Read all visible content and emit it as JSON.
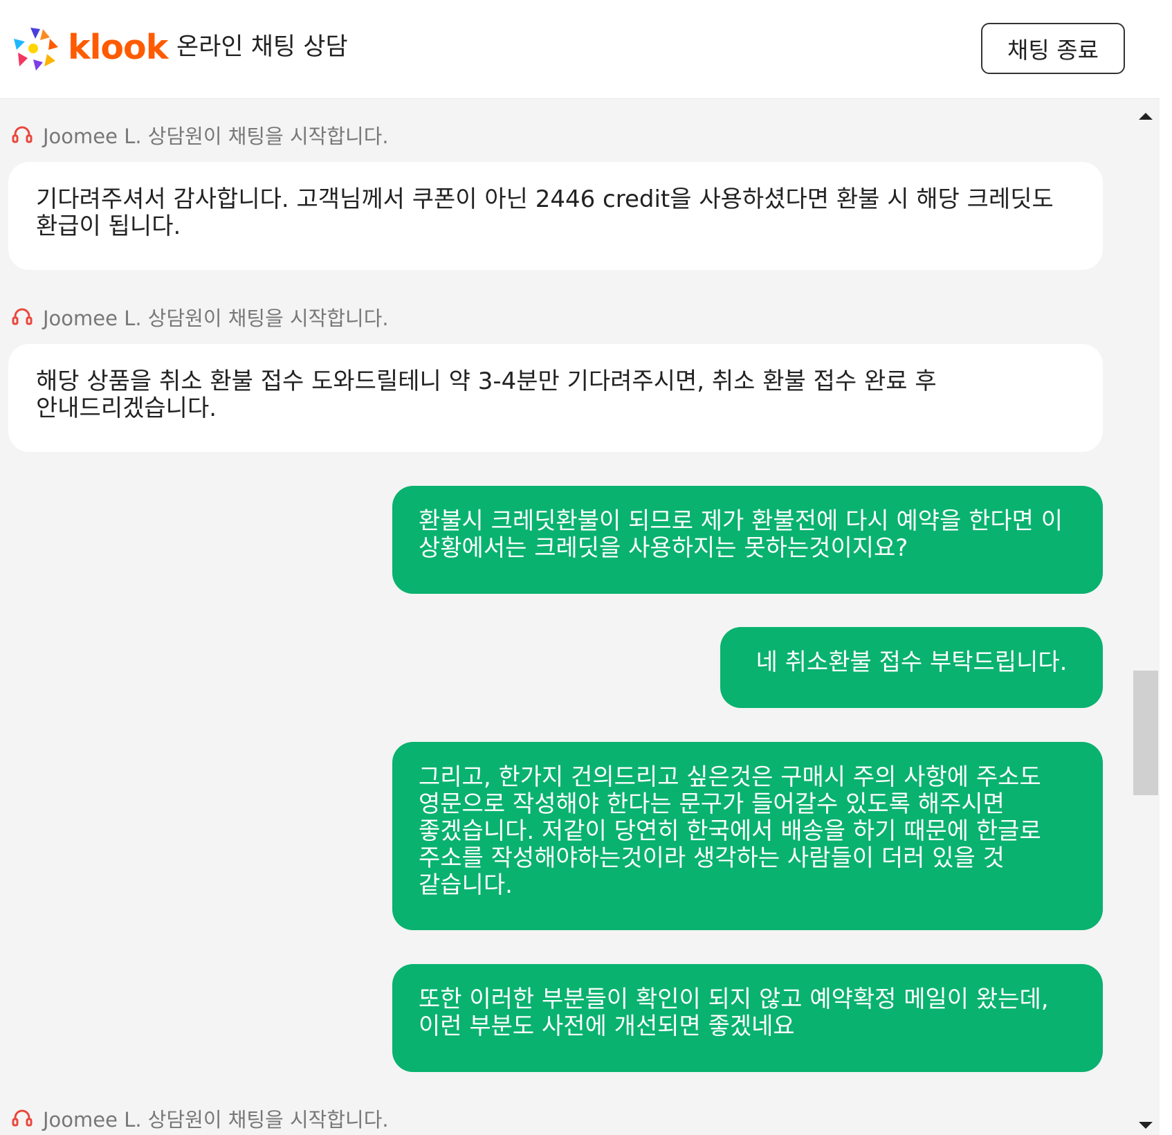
{
  "header": {
    "logo_text": "klook",
    "title": "온라인 채팅 상담",
    "end_button": "채팅 종료"
  },
  "messages": [
    {
      "type": "system",
      "text": "Joomee L. 상담원이 채팅을 시작합니다."
    },
    {
      "type": "agent",
      "text": "기다려주셔서 감사합니다. 고객님께서 쿠폰이 아닌 2446 credit을 사용하셨다면 환불 시 해당 크레딧도 환급이 됩니다."
    },
    {
      "type": "system",
      "text": "Joomee L. 상담원이 채팅을 시작합니다."
    },
    {
      "type": "agent",
      "text": "해당 상품을 취소 환불 접수 도와드릴테니 약 3-4분만 기다려주시면, 취소 환불 접수 완료 후 안내드리겠습니다."
    },
    {
      "type": "user",
      "text": "환불시 크레딧환불이 되므로 제가 환불전에 다시 예약을 한다면 이 상황에서는 크레딧을 사용하지는 못하는것이지요?"
    },
    {
      "type": "user",
      "text": "네 취소환불 접수 부탁드립니다."
    },
    {
      "type": "user",
      "text": "그리고, 한가지 건의드리고 싶은것은 구매시 주의 사항에 주소도 영문으로 작성해야 한다는 문구가 들어갈수 있도록 해주시면 좋겠습니다. 저같이 당연히 한국에서 배송을 하기 때문에 한글로 주소를 작성해야하는것이라 생각하는 사람들이 더러 있을 것 같습니다."
    },
    {
      "type": "user",
      "text": "또한 이러한 부분들이 확인이 되지 않고 예약확정 메일이 왔는데, 이런 부분도 사전에 개선되면 좋겠네요"
    },
    {
      "type": "system",
      "text": "Joomee L. 상담원이 채팅을 시작합니다."
    }
  ],
  "icons": {
    "headset": "headset-icon",
    "logo": "klook-logo-icon",
    "scroll_up": "scroll-up-arrow-icon",
    "scroll_down": "scroll-down-arrow-icon"
  },
  "colors": {
    "brand": "#ff5b00",
    "user_bubble": "#09b26f",
    "agent_bubble": "#ffffff",
    "background": "#f4f4f4",
    "headset_icon": "#e8473c"
  }
}
